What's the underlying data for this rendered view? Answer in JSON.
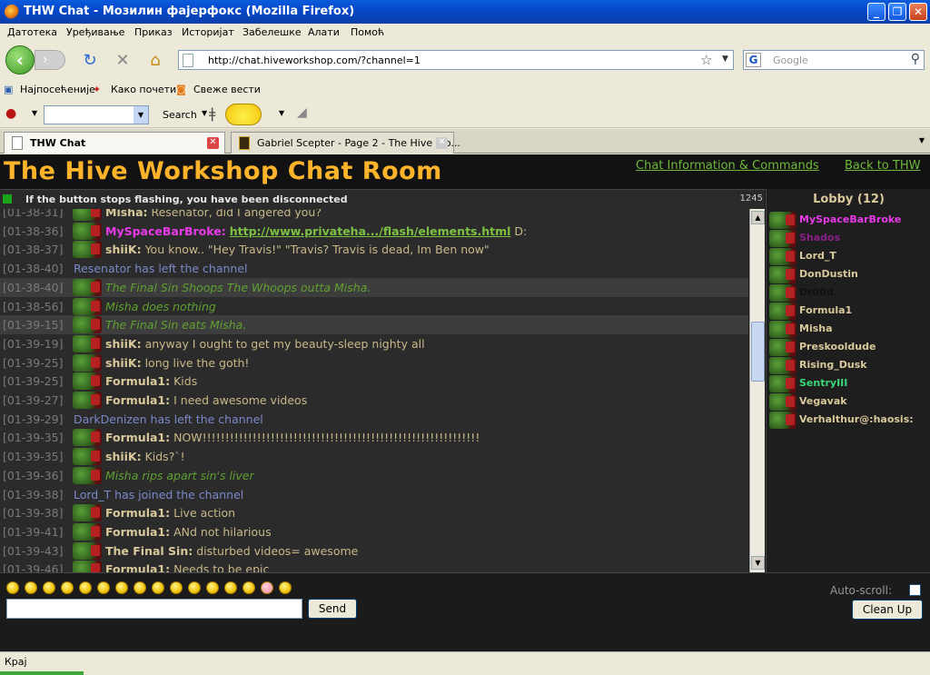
{
  "window": {
    "title": "THW Chat - Мозилин фајерфокс (Mozilla Firefox)"
  },
  "menu": [
    "Датотека",
    "Уређивање",
    "Приказ",
    "Историјат",
    "Забелешке",
    "Алати",
    "Помоћ"
  ],
  "nav": {
    "url": "http://chat.hiveworkshop.com/?channel=1",
    "search_placeholder": "Google"
  },
  "bookmarks": [
    "Најпосећеније",
    "Како почети",
    "Свеже вести"
  ],
  "toolbar2": {
    "search_label": "Search"
  },
  "tabs": [
    {
      "label": "THW Chat",
      "active": true
    },
    {
      "label": "Gabriel Scepter - Page 2 - The Hive Wo...",
      "active": false
    }
  ],
  "page": {
    "title": "The Hive Workshop Chat Room",
    "links": [
      "Chat Information & Commands",
      "Back to THW"
    ],
    "status_text": "If the button stops flashing, you have been disconnected",
    "count": "1245"
  },
  "messages": [
    {
      "ts": "[01-38-31]",
      "type": "msg",
      "name": "Misha:",
      "text": "Resenator, did I angered you?"
    },
    {
      "ts": "[01-38-36]",
      "type": "msg",
      "name": "MySpaceBarBroke:",
      "text": "http://www.privateha.../flash/elements.html",
      "suffix": "D:",
      "name_color": "#e83ae8",
      "link": true
    },
    {
      "ts": "[01-38-37]",
      "type": "msg",
      "name": "shiiK:",
      "text": "You know.. \"Hey Travis!\" \"Travis? Travis is dead, Im Ben now\""
    },
    {
      "ts": "[01-38-40]",
      "type": "sys",
      "text": "Resenator has left the channel"
    },
    {
      "ts": "[01-38-40]",
      "type": "act",
      "text": "The Final Sin Shoops The Whoops outta Misha.",
      "hl": true
    },
    {
      "ts": "[01-38-56]",
      "type": "act",
      "text": "Misha does nothing"
    },
    {
      "ts": "[01-39-15]",
      "type": "act",
      "text": "The Final Sin eats Misha.",
      "hl": true
    },
    {
      "ts": "[01-39-19]",
      "type": "msg",
      "name": "shiiK:",
      "text": "anyway I ought to get my beauty-sleep nighty all"
    },
    {
      "ts": "[01-39-25]",
      "type": "msg",
      "name": "shiiK:",
      "text": "long live the goth!"
    },
    {
      "ts": "[01-39-25]",
      "type": "msg",
      "name": "Formula1:",
      "text": "Kids"
    },
    {
      "ts": "[01-39-27]",
      "type": "msg",
      "name": "Formula1:",
      "text": "I need awesome videos"
    },
    {
      "ts": "[01-39-29]",
      "type": "sys",
      "text": "DarkDenizen has left the channel"
    },
    {
      "ts": "[01-39-35]",
      "type": "msg",
      "name": "Formula1:",
      "text": "NOW!!!!!!!!!!!!!!!!!!!!!!!!!!!!!!!!!!!!!!!!!!!!!!!!!!!!!!!!!!!!!"
    },
    {
      "ts": "[01-39-35]",
      "type": "msg",
      "name": "shiiK:",
      "text": "Kids?`!"
    },
    {
      "ts": "[01-39-36]",
      "type": "act",
      "text": "Misha rips apart sin's liver"
    },
    {
      "ts": "[01-39-38]",
      "type": "sys",
      "text": "Lord_T has joined the channel"
    },
    {
      "ts": "[01-39-38]",
      "type": "msg",
      "name": "Formula1:",
      "text": "Live action"
    },
    {
      "ts": "[01-39-41]",
      "type": "msg",
      "name": "Formula1:",
      "text": "ANd not hilarious"
    },
    {
      "ts": "[01-39-43]",
      "type": "msg",
      "name": "The Final Sin:",
      "text": "disturbed videos= awesome"
    },
    {
      "ts": "[01-39-46]",
      "type": "msg",
      "name": "Formula1:",
      "text": "Needs to be epic"
    }
  ],
  "lobby": {
    "title": "Lobby (12)",
    "users": [
      {
        "name": "MySpaceBarBroke",
        "color": "#e83ae8"
      },
      {
        "name": "Shados",
        "color": "#8a1f8a"
      },
      {
        "name": "Lord_T",
        "color": "#d9c89a"
      },
      {
        "name": "DonDustin",
        "color": "#d9c89a"
      },
      {
        "name": "Dr00d",
        "color": "#111111"
      },
      {
        "name": "Formula1",
        "color": "#d9c89a"
      },
      {
        "name": "Misha",
        "color": "#d9c89a"
      },
      {
        "name": "Preskooldude",
        "color": "#d9c89a"
      },
      {
        "name": "Rising_Dusk",
        "color": "#d9c89a"
      },
      {
        "name": "SentryIII",
        "color": "#3ad67a"
      },
      {
        "name": "Vegavak",
        "color": "#d9c89a"
      },
      {
        "name": "Verhalthur@:haosis:",
        "color": "#d9c89a"
      }
    ]
  },
  "input": {
    "send_label": "Send",
    "autoscroll_label": "Auto-scroll:",
    "cleanup_label": "Clean Up"
  },
  "statusbar": {
    "text": "Крај"
  }
}
